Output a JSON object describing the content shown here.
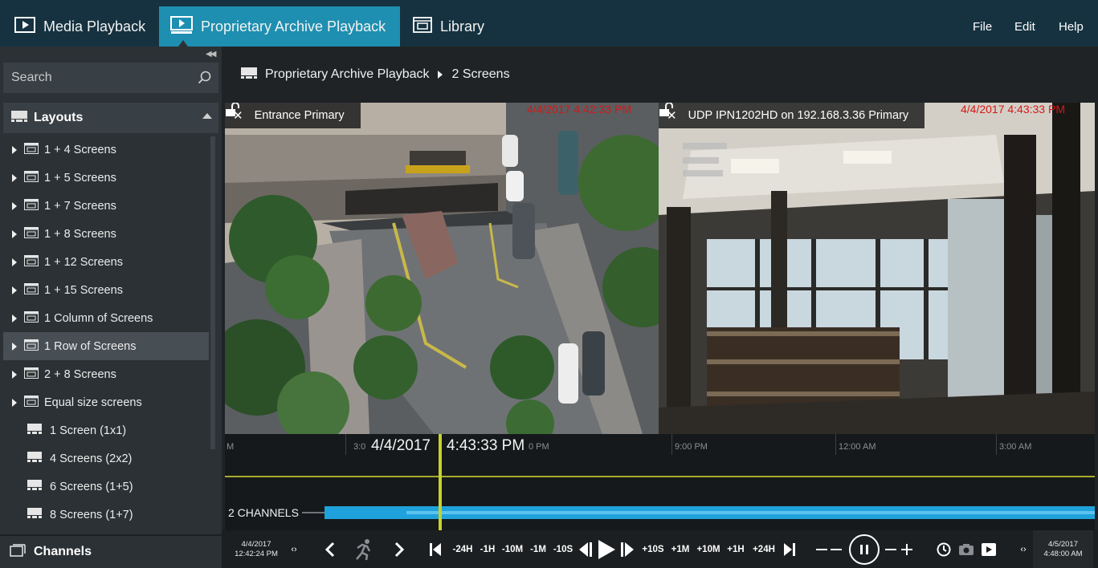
{
  "menubar": {
    "tabs": [
      {
        "label": "Media Playback",
        "active": false
      },
      {
        "label": "Proprietary Archive Playback",
        "active": true
      },
      {
        "label": "Library",
        "active": false
      }
    ],
    "menus": [
      "File",
      "Edit",
      "Help"
    ]
  },
  "sidebar": {
    "search_placeholder": "Search",
    "layouts_title": "Layouts",
    "layout_groups": [
      "1 + 4 Screens",
      "1 + 5 Screens",
      "1 + 7 Screens",
      "1 + 8 Screens",
      "1 + 12 Screens",
      "1 + 15 Screens",
      "1 Column of Screens",
      "1 Row of Screens",
      "2 + 8 Screens",
      "Equal size screens"
    ],
    "selected_group": "1 Row of Screens",
    "layouts": [
      "1 Screen (1x1)",
      "4 Screens (2x2)",
      "6 Screens (1+5)",
      "8 Screens (1+7)"
    ],
    "channels_title": "Channels"
  },
  "breadcrumb": {
    "root": "Proprietary Archive Playback",
    "current": "2 Screens"
  },
  "panes": [
    {
      "title": "Entrance Primary",
      "timestamp": "4/4/2017 4:42:33 PM"
    },
    {
      "title": "UDP IPN1202HD on 192.168.3.36 Primary",
      "timestamp": "4/4/2017 4:43:33 PM"
    }
  ],
  "timeline": {
    "cursor_date": "4/4/2017",
    "cursor_time": "4:43:33 PM",
    "ticks": [
      "M",
      "3:0",
      "0 PM",
      "9:00 PM",
      "12:00 AM",
      "3:00 AM"
    ],
    "channels_label": "2 CHANNELS"
  },
  "controls": {
    "start_date": "4/4/2017",
    "start_time": "12:42:24 PM",
    "end_date": "4/5/2017",
    "end_time": "4:48:00 AM",
    "jump_back": [
      "-24H",
      "-1H",
      "-10M",
      "-1M",
      "-10S"
    ],
    "jump_forward": [
      "+10S",
      "+1M",
      "+10M",
      "+1H",
      "+24H"
    ]
  },
  "colors": {
    "menubar_bg": "#163240",
    "active_tab": "#1e8fb0",
    "sidebar_bg": "#2b3135",
    "timestamp_red": "#d61818",
    "cursor_yellow": "#c6d22a",
    "channel_blue": "#1fa2db"
  }
}
